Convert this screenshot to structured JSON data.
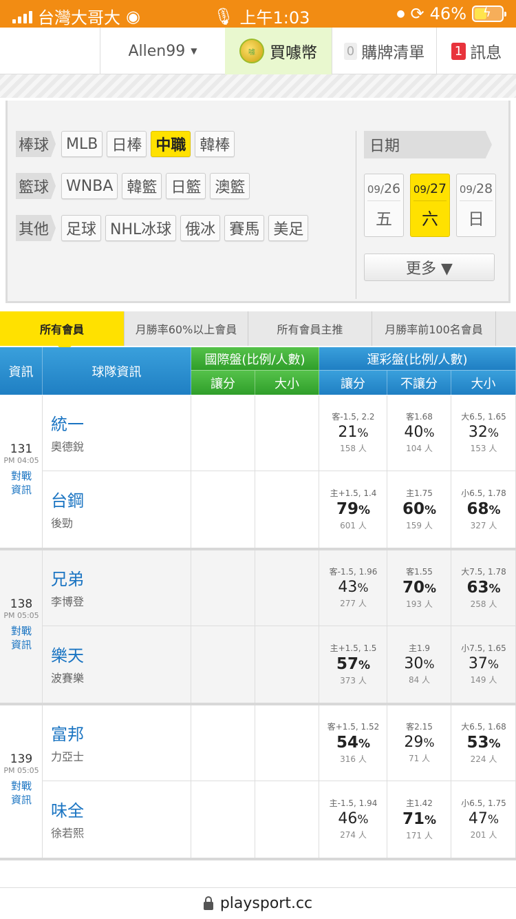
{
  "status": {
    "carrier": "台灣大哥大",
    "time": "上午1:03",
    "battery": "46%",
    "battery_level": 0.46
  },
  "nav": {
    "user": "Allen99",
    "buy": "買噱幣",
    "coin": "噱",
    "cart_count": "0",
    "cart": "購牌清單",
    "msg_count": "1",
    "msg": "訊息"
  },
  "filters": {
    "rows": [
      {
        "label": "棒球",
        "items": [
          "MLB",
          "日棒",
          "中職",
          "韓棒"
        ],
        "active": 2
      },
      {
        "label": "籃球",
        "items": [
          "WNBA",
          "韓籃",
          "日籃",
          "澳籃"
        ],
        "active": -1
      },
      {
        "label": "其他",
        "items": [
          "足球",
          "NHL冰球",
          "俄冰",
          "賽馬",
          "美足"
        ],
        "active": -1
      }
    ],
    "date_label": "日期",
    "dates": [
      {
        "m": "09/",
        "d": "26",
        "w": "五"
      },
      {
        "m": "09/",
        "d": "27",
        "w": "六"
      },
      {
        "m": "09/",
        "d": "28",
        "w": "日"
      }
    ],
    "date_active": 1,
    "more": "更多 ▼"
  },
  "tabs": [
    "所有會員",
    "月勝率60%以上會員",
    "所有會員主推",
    "月勝率前100名會員"
  ],
  "table_head": {
    "info": "資訊",
    "team": "球隊資訊",
    "intl": "國際盤(比例/人數)",
    "intl_spread": "讓分",
    "intl_total": "大小",
    "lottery": "運彩盤(比例/人數)",
    "spread": "讓分",
    "nospread": "不讓分",
    "total": "大小"
  },
  "games": [
    {
      "no": "131",
      "time": "PM 04:05",
      "link1": "對戰",
      "link2": "資訊",
      "teams": [
        {
          "name": "統一",
          "pitcher": "奧德銳",
          "odds": [
            {
              "line": "客-1.5, 2.2",
              "pct": "21",
              "cnt": "158 人",
              "big": false
            },
            {
              "line": "客1.68",
              "pct": "40",
              "cnt": "104 人",
              "big": false
            },
            {
              "line": "大6.5, 1.65",
              "pct": "32",
              "cnt": "153 人",
              "big": false
            }
          ]
        },
        {
          "name": "台鋼",
          "pitcher": "後勁",
          "odds": [
            {
              "line": "主+1.5, 1.4",
              "pct": "79",
              "cnt": "601 人",
              "big": true
            },
            {
              "line": "主1.75",
              "pct": "60",
              "cnt": "159 人",
              "big": true
            },
            {
              "line": "小6.5, 1.78",
              "pct": "68",
              "cnt": "327 人",
              "big": true
            }
          ]
        }
      ]
    },
    {
      "no": "138",
      "time": "PM 05:05",
      "link1": "對戰",
      "link2": "資訊",
      "teams": [
        {
          "name": "兄弟",
          "pitcher": "李博登",
          "odds": [
            {
              "line": "客-1.5, 1.96",
              "pct": "43",
              "cnt": "277 人",
              "big": false
            },
            {
              "line": "客1.55",
              "pct": "70",
              "cnt": "193 人",
              "big": true
            },
            {
              "line": "大7.5, 1.78",
              "pct": "63",
              "cnt": "258 人",
              "big": true
            }
          ]
        },
        {
          "name": "樂天",
          "pitcher": "波賽樂",
          "odds": [
            {
              "line": "主+1.5, 1.5",
              "pct": "57",
              "cnt": "373 人",
              "big": true
            },
            {
              "line": "主1.9",
              "pct": "30",
              "cnt": "84 人",
              "big": false
            },
            {
              "line": "小7.5, 1.65",
              "pct": "37",
              "cnt": "149 人",
              "big": false
            }
          ]
        }
      ]
    },
    {
      "no": "139",
      "time": "PM 05:05",
      "link1": "對戰",
      "link2": "資訊",
      "teams": [
        {
          "name": "富邦",
          "pitcher": "力亞士",
          "odds": [
            {
              "line": "客+1.5, 1.52",
              "pct": "54",
              "cnt": "316 人",
              "big": true
            },
            {
              "line": "客2.15",
              "pct": "29",
              "cnt": "71 人",
              "big": false
            },
            {
              "line": "大6.5, 1.68",
              "pct": "53",
              "cnt": "224 人",
              "big": true
            }
          ]
        },
        {
          "name": "味全",
          "pitcher": "徐若熙",
          "odds": [
            {
              "line": "主-1.5, 1.94",
              "pct": "46",
              "cnt": "274 人",
              "big": false
            },
            {
              "line": "主1.42",
              "pct": "71",
              "cnt": "171 人",
              "big": true
            },
            {
              "line": "小6.5, 1.75",
              "pct": "47",
              "cnt": "201 人",
              "big": false
            }
          ]
        }
      ]
    }
  ],
  "url": "playsport.cc",
  "colors": {
    "status_bar": "#f28c13",
    "accent": "#ffe100",
    "header_blue": "#1f7fc3",
    "header_green": "#2f9e2a",
    "link": "#1a74c2"
  }
}
